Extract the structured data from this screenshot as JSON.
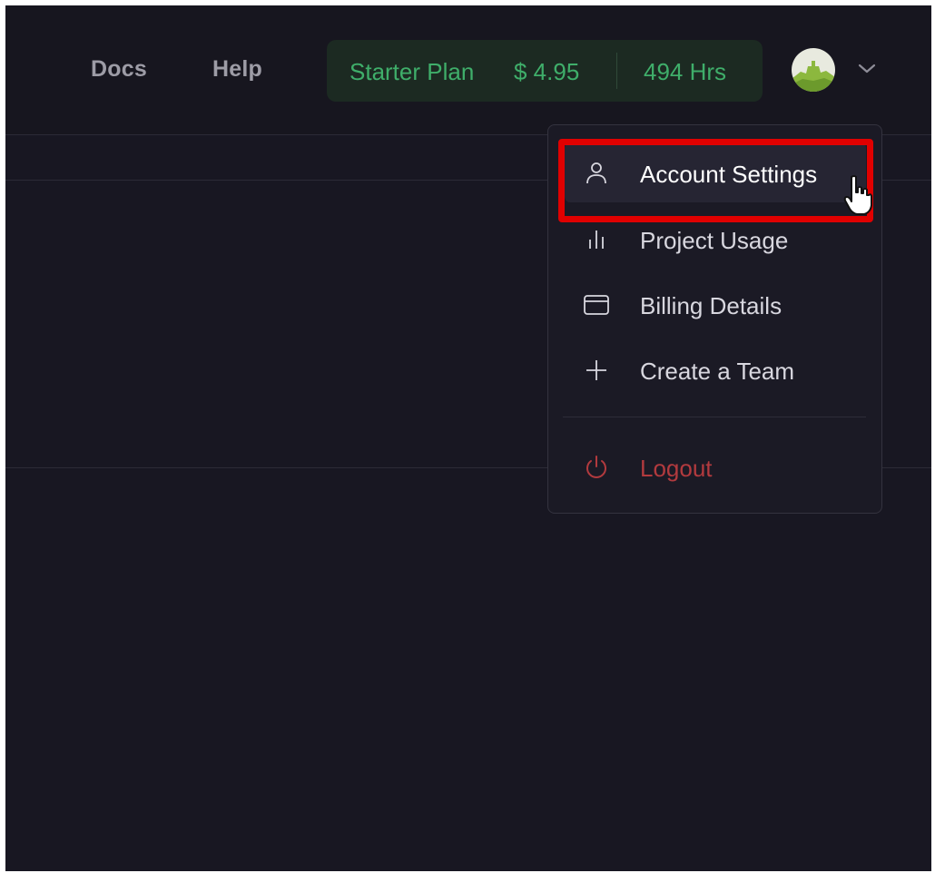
{
  "header": {
    "nav": [
      {
        "label": "Docs"
      },
      {
        "label": "Help"
      }
    ],
    "plan": {
      "name": "Starter Plan",
      "price": "$ 4.95",
      "hours": "494 Hrs"
    },
    "avatar_icon": "user-avatar-icon",
    "menu_toggle_icon": "chevron-down-icon"
  },
  "dropdown": {
    "items": [
      {
        "label": "Account Settings",
        "icon": "user-icon",
        "state": "hovered"
      },
      {
        "label": "Project Usage",
        "icon": "bar-chart-icon"
      },
      {
        "label": "Billing Details",
        "icon": "credit-card-icon"
      },
      {
        "label": "Create a Team",
        "icon": "plus-icon"
      }
    ],
    "logout": {
      "label": "Logout",
      "icon": "power-icon"
    }
  },
  "colors": {
    "background": "#181722",
    "plan_text": "#3fae6a",
    "logout": "#b23a3e",
    "highlight": "#e00000"
  }
}
